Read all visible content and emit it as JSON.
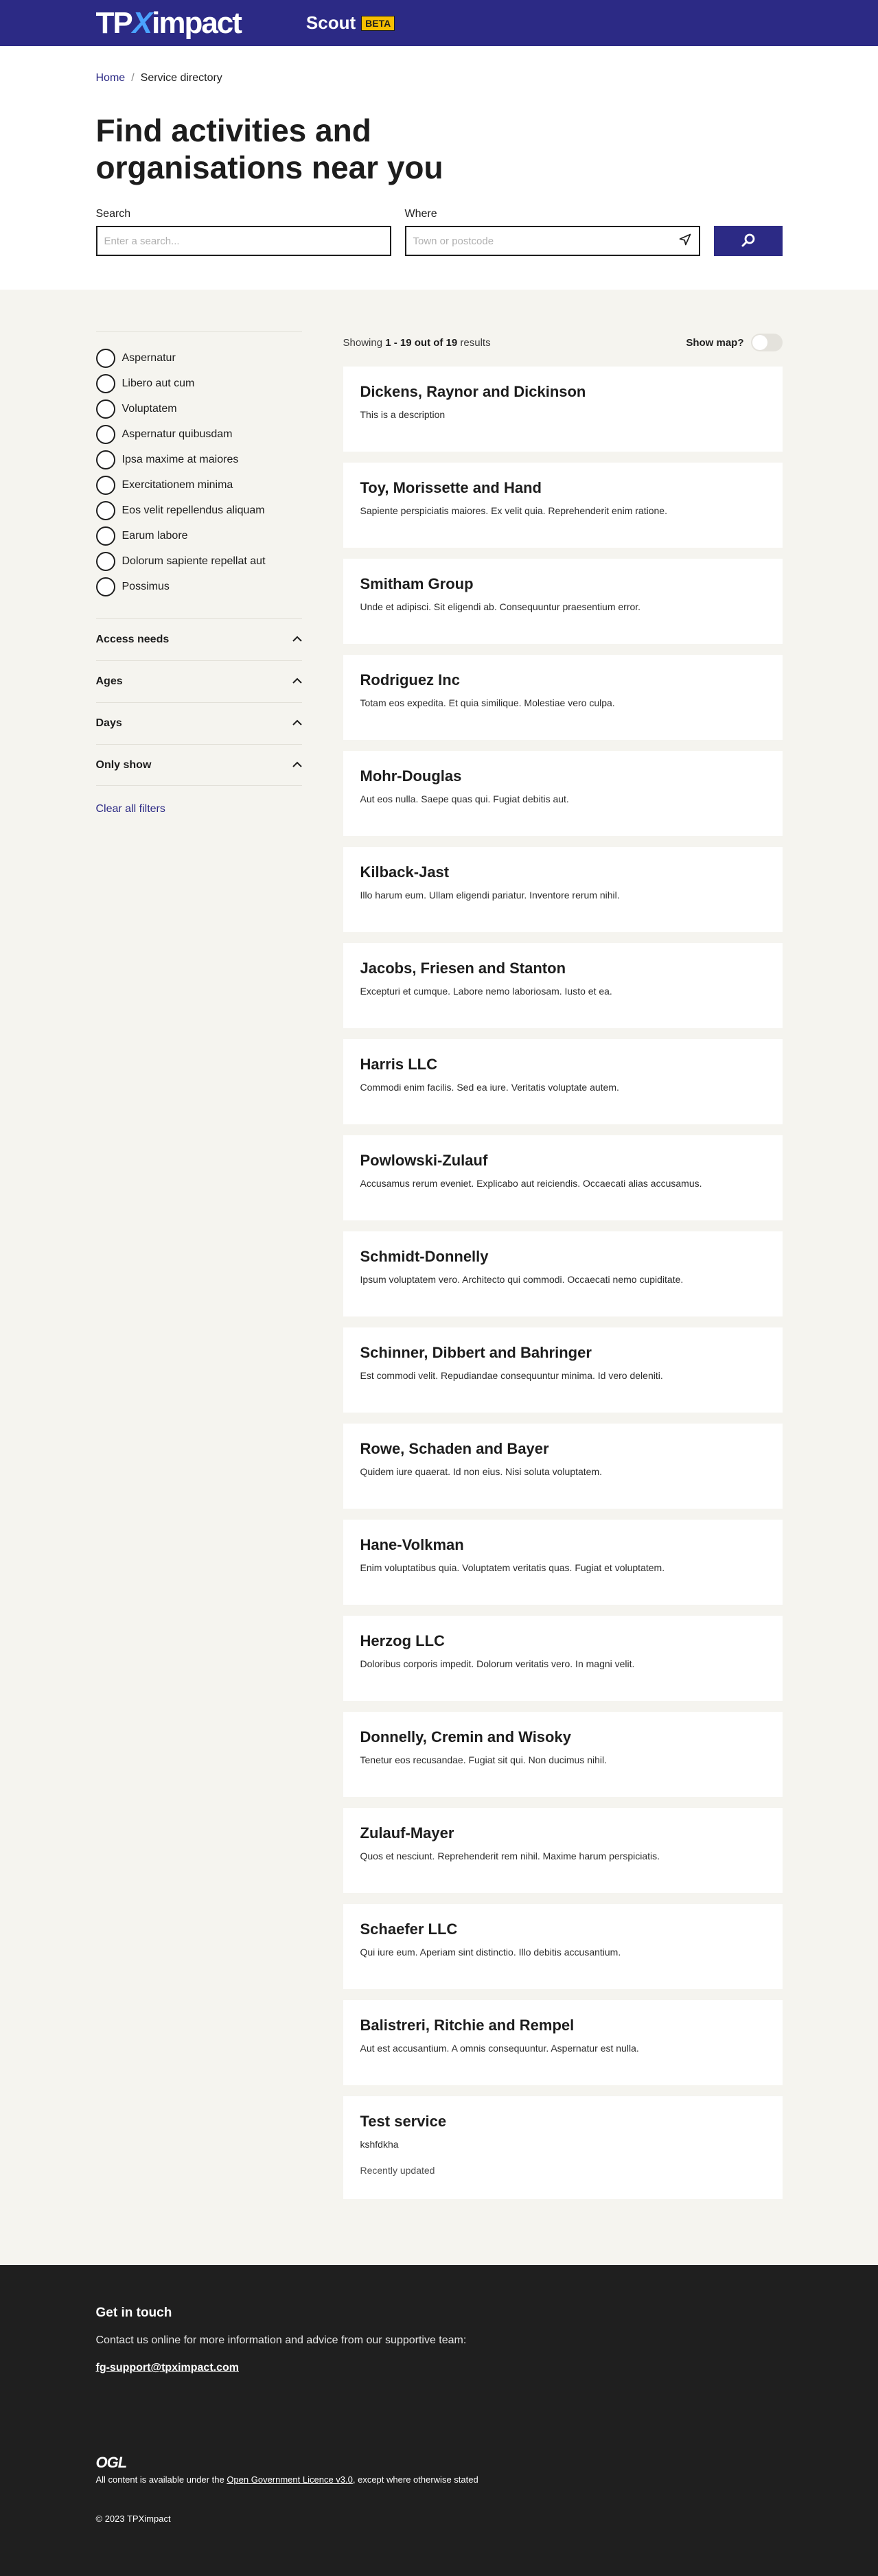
{
  "header": {
    "logo_left": "TP",
    "logo_x": "X",
    "logo_right": "impact",
    "app_name": "Scout",
    "badge": "BETA",
    "colors": {
      "brand": "#2c2a85",
      "badge": "#f6be00",
      "logo_x": "#4aa3ff"
    }
  },
  "breadcrumb": {
    "home": "Home",
    "separator": "/",
    "current": "Service directory"
  },
  "hero": {
    "title": "Find activities and organisations near you",
    "search_label": "Search",
    "search_placeholder": "Enter a search...",
    "where_label": "Where",
    "where_placeholder": "Town or postcode",
    "icons": {
      "location": "location-arrow-icon",
      "search": "search-icon"
    }
  },
  "sidebar": {
    "categories": [
      "Aspernatur",
      "Libero aut cum",
      "Voluptatem",
      "Aspernatur quibusdam",
      "Ipsa maxime at maiores",
      "Exercitationem minima",
      "Eos velit repellendus aliquam",
      "Earum labore",
      "Dolorum sapiente repellat aut",
      "Possimus"
    ],
    "filters": [
      "Access needs",
      "Ages",
      "Days",
      "Only show"
    ],
    "clear": "Clear all filters"
  },
  "results": {
    "showing_prefix": "Showing",
    "range": "1 - 19 out of 19",
    "showing_suffix": "results",
    "show_map": "Show map?",
    "items": [
      {
        "name": "Dickens, Raynor and Dickinson",
        "description": "This is a description"
      },
      {
        "name": "Toy, Morissette and Hand",
        "description": "Sapiente perspiciatis maiores. Ex velit quia. Reprehenderit enim ratione."
      },
      {
        "name": "Smitham Group",
        "description": "Unde et adipisci. Sit eligendi ab. Consequuntur praesentium error."
      },
      {
        "name": "Rodriguez Inc",
        "description": "Totam eos expedita. Et quia similique. Molestiae vero culpa."
      },
      {
        "name": "Mohr-Douglas",
        "description": "Aut eos nulla. Saepe quas qui. Fugiat debitis aut."
      },
      {
        "name": "Kilback-Jast",
        "description": "Illo harum eum. Ullam eligendi pariatur. Inventore rerum nihil."
      },
      {
        "name": "Jacobs, Friesen and Stanton",
        "description": "Excepturi et cumque. Labore nemo laboriosam. Iusto et ea."
      },
      {
        "name": "Harris LLC",
        "description": "Commodi enim facilis. Sed ea iure. Veritatis voluptate autem."
      },
      {
        "name": "Powlowski-Zulauf",
        "description": "Accusamus rerum eveniet. Explicabo aut reiciendis. Occaecati alias accusamus."
      },
      {
        "name": "Schmidt-Donnelly",
        "description": "Ipsum voluptatem vero. Architecto qui commodi. Occaecati nemo cupiditate."
      },
      {
        "name": "Schinner, Dibbert and Bahringer",
        "description": "Est commodi velit. Repudiandae consequuntur minima. Id vero deleniti."
      },
      {
        "name": "Rowe, Schaden and Bayer",
        "description": "Quidem iure quaerat. Id non eius. Nisi soluta voluptatem."
      },
      {
        "name": "Hane-Volkman",
        "description": "Enim voluptatibus quia. Voluptatem veritatis quas. Fugiat et voluptatem."
      },
      {
        "name": "Herzog LLC",
        "description": "Doloribus corporis impedit. Dolorum veritatis vero. In magni velit."
      },
      {
        "name": "Donnelly, Cremin and Wisoky",
        "description": "Tenetur eos recusandae. Fugiat sit qui. Non ducimus nihil."
      },
      {
        "name": "Zulauf-Mayer",
        "description": "Quos et nesciunt. Reprehenderit rem nihil. Maxime harum perspiciatis."
      },
      {
        "name": "Schaefer LLC",
        "description": "Qui iure eum. Aperiam sint distinctio. Illo debitis accusantium."
      },
      {
        "name": "Balistreri, Ritchie and Rempel",
        "description": "Aut est accusantium. A omnis consequuntur. Aspernatur est nulla."
      },
      {
        "name": "Test service",
        "description": "kshfdkha",
        "updated": "Recently updated"
      }
    ]
  },
  "footer": {
    "heading": "Get in touch",
    "contact_text": "Contact us online for more information and advice from our supportive team:",
    "email": "fg-support@tpximpact.com",
    "ogl": "OGL",
    "licence_prefix": "All content is available under the",
    "licence_link": "Open Government Licence v3.0",
    "licence_suffix": ", except where otherwise stated",
    "copyright": "© 2023 TPXimpact"
  }
}
